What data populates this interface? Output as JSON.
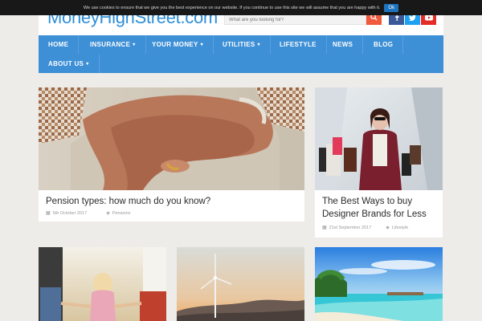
{
  "cookie": {
    "text": "We use cookies to ensure that we give you the best experience on our website. If you continue to use this site we will assume that you are happy with it.",
    "ok_label": "Ok"
  },
  "header": {
    "logo": "MoneyHighStreet.com",
    "search_placeholder": "What are you looking for?"
  },
  "nav": {
    "items": [
      {
        "label": "HOME"
      },
      {
        "label": "INSURANCE",
        "caret": "▾"
      },
      {
        "label": "YOUR MONEY",
        "caret": "▾"
      },
      {
        "label": "UTILITIES",
        "caret": "▾"
      },
      {
        "label": "LIFESTYLE"
      },
      {
        "label": "NEWS"
      },
      {
        "label": "BLOG"
      },
      {
        "label": "ABOUT US",
        "caret": "▾"
      }
    ]
  },
  "articles": [
    {
      "title": "Pension types: how much do you know?",
      "date": "5th October 2017",
      "category": "Pensions"
    },
    {
      "title": "The Best Ways to buy Designer Brands for Less",
      "date": "21st September 2017",
      "category": "Lifestyle"
    }
  ],
  "icons": {
    "search": "search-icon",
    "facebook": "facebook-icon",
    "twitter": "twitter-icon",
    "youtube": "youtube-icon",
    "calendar": "calendar-icon",
    "tag": "tag-icon"
  },
  "colors": {
    "brand": "#2d8ed8",
    "nav": "#3d8fd6",
    "search_button": "#ef5a3c",
    "cookie_ok": "#1e73be"
  }
}
